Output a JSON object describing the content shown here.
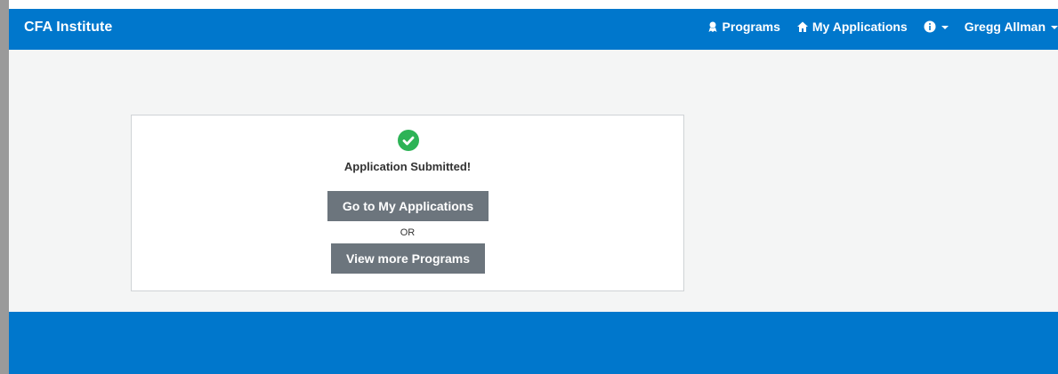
{
  "header": {
    "brand": "CFA Institute",
    "nav": {
      "programs": "Programs",
      "my_applications": "My Applications",
      "user": "Gregg Allman"
    }
  },
  "card": {
    "status": "Application Submitted!",
    "primary_button": "Go to My Applications",
    "separator": "OR",
    "secondary_button": "View more Programs"
  },
  "icons": {
    "programs": "award-ribbon-icon",
    "my_applications": "home-icon",
    "info": "info-circle-icon",
    "success": "check-circle-icon"
  },
  "colors": {
    "brand_blue": "#0077cc",
    "success_green": "#2db356",
    "button_gray": "#6c757d",
    "background": "#f4f5f5"
  }
}
